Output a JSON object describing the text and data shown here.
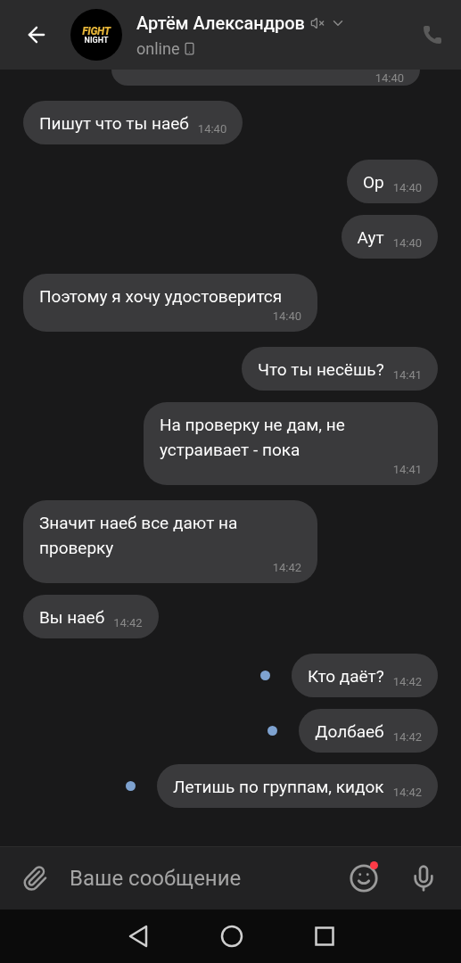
{
  "header": {
    "avatar_logo": [
      "FIGHT",
      "NIGHT"
    ],
    "name": "Артём Александров",
    "muted": true,
    "status": "online",
    "call_enabled": false
  },
  "messages": [
    {
      "kind": "partial",
      "time": "14:40"
    },
    {
      "kind": "in",
      "text": "Пишут что ты наеб",
      "time": "14:40",
      "unread": false
    },
    {
      "kind": "out",
      "text": "Ор",
      "time": "14:40",
      "unread": false
    },
    {
      "kind": "out",
      "text": "Аут",
      "time": "14:40",
      "unread": false
    },
    {
      "kind": "in",
      "text": "Поэтому я хочу удостоверится",
      "time": "14:40",
      "unread": false
    },
    {
      "kind": "out",
      "text": "Что ты несёшь?",
      "time": "14:41",
      "unread": false
    },
    {
      "kind": "out",
      "text": "На проверку не дам, не устраивает - пока",
      "time": "14:41",
      "unread": false
    },
    {
      "kind": "in",
      "text": "Значит наеб все дают на проверку",
      "time": "14:42",
      "unread": false
    },
    {
      "kind": "in",
      "text": "Вы наеб",
      "time": "14:42",
      "unread": false
    },
    {
      "kind": "out",
      "text": "Кто даёт?",
      "time": "14:42",
      "unread": true
    },
    {
      "kind": "out",
      "text": "Долбаеб",
      "time": "14:42",
      "unread": true
    },
    {
      "kind": "out",
      "text": "Летишь по группам, кидок",
      "time": "14:42",
      "unread": true
    }
  ],
  "composer": {
    "placeholder": "Ваше сообщение",
    "sticker_badge": true
  }
}
